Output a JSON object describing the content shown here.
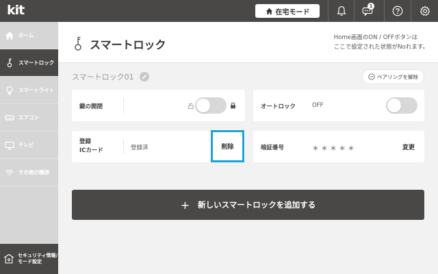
{
  "app": {
    "logo": "kit"
  },
  "topbar": {
    "mode_button": "在宅モード",
    "notification_badge": "1"
  },
  "sidebar": {
    "items": [
      {
        "label": "ホーム",
        "icon": "home-icon"
      },
      {
        "label": "スマートロック",
        "icon": "key-icon",
        "active": true
      },
      {
        "label": "スマートライト",
        "icon": "light-bulb-icon"
      },
      {
        "label": "エアコン",
        "icon": "air-conditioner-icon"
      },
      {
        "label": "テレビ",
        "icon": "tv-icon"
      },
      {
        "label": "その他の機器",
        "icon": "wifi-icon"
      }
    ],
    "bottom": {
      "line1": "セキュリティ情報/",
      "line2": "モード設定",
      "icon": "security-settings-icon"
    }
  },
  "header": {
    "title": "スマートロック",
    "note_line1": "Home画面のON / OFFボタンは",
    "note_line2": "ここで設定された状態がNoれます。"
  },
  "device": {
    "name": "スマートロック01",
    "pairing_button": "ペアリングを解除"
  },
  "cards": {
    "lock": {
      "label": "鍵の開閉",
      "toggle_on": false
    },
    "autolock": {
      "label": "オートロック",
      "value": "OFF",
      "toggle_on": false
    },
    "ic_card": {
      "label_line1": "登録",
      "label_line2": "ICカード",
      "value": "登録済",
      "action": "削除"
    },
    "pin": {
      "label": "暗証番号",
      "value": "＊＊＊＊＊",
      "action": "変更"
    }
  },
  "add_button": {
    "plus": "+",
    "label": "新しいスマートロックを追加する"
  },
  "colors": {
    "dark": "#4a4846",
    "sidebar": "#d6d6d6",
    "highlight": "#1aa3d6",
    "background": "#f2f2f2"
  }
}
